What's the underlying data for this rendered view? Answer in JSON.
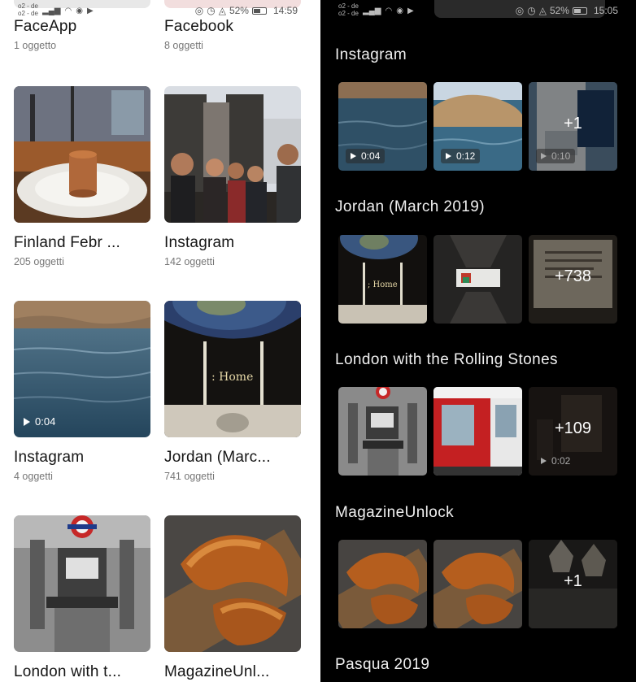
{
  "left": {
    "status": {
      "carrier_1": "o2 - de",
      "carrier_2": "o2 - de",
      "battery": "52%",
      "time": "14:59"
    },
    "top_albums": [
      {
        "title": "FaceApp",
        "count": "1 oggetto"
      },
      {
        "title": "Facebook",
        "count": "8 oggetti"
      }
    ],
    "albums": [
      {
        "title": "Finland Febr ...",
        "count": "205 oggetti"
      },
      {
        "title": "Instagram",
        "count": "142 oggetti"
      },
      {
        "title": "Instagram",
        "count": "4 oggetti",
        "duration": "0:04"
      },
      {
        "title": "Jordan (Marc...",
        "count": "741 oggetti"
      },
      {
        "title": "London with t...",
        "count": ""
      },
      {
        "title": "MagazineUnl...",
        "count": ""
      }
    ],
    "thumb_text": {
      "home": ": Home"
    }
  },
  "right": {
    "status": {
      "carrier_1": "o2 - de",
      "carrier_2": "o2 - de",
      "battery": "52%",
      "time": "15:05"
    },
    "sections": [
      {
        "title": "Instagram",
        "tiles": [
          {
            "badge": "0:04"
          },
          {
            "badge": "0:12"
          },
          {
            "badge": "0:10",
            "more": "+1"
          }
        ]
      },
      {
        "title": "Jordan (March 2019)",
        "tiles": [
          {
            "caption": "; Home"
          },
          {
            "caption": ""
          },
          {
            "more": "+738"
          }
        ]
      },
      {
        "title": "London with the Rolling Stones",
        "tiles": [
          {
            "caption": ""
          },
          {
            "caption": ""
          },
          {
            "badge": "0:02",
            "more": "+109"
          }
        ]
      },
      {
        "title": "MagazineUnlock",
        "tiles": [
          {
            "caption": ""
          },
          {
            "caption": ""
          },
          {
            "more": "+1"
          }
        ]
      },
      {
        "title": "Pasqua 2019",
        "tiles": []
      }
    ]
  }
}
